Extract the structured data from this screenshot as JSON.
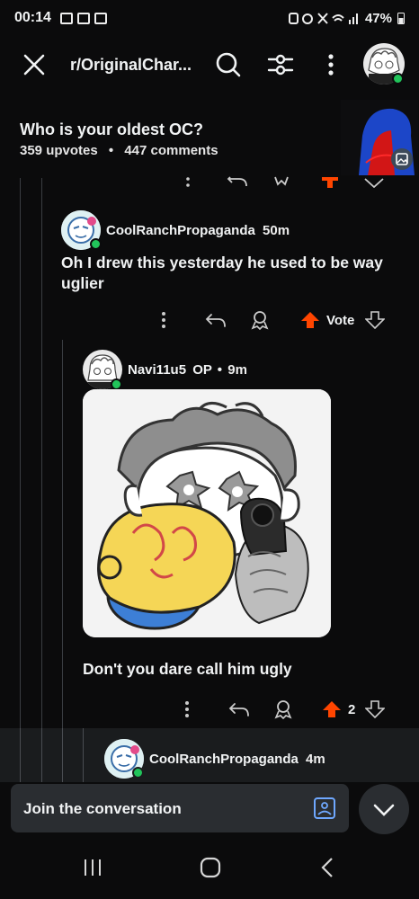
{
  "status_bar": {
    "time": "00:14",
    "battery": "47%"
  },
  "header": {
    "subreddit": "r/OriginalChar..."
  },
  "post": {
    "title": "Who is your oldest OC?",
    "upvotes": "359 upvotes",
    "separator": "•",
    "comments": "447 comments"
  },
  "comments": [
    {
      "user": "CoolRanchPropaganda",
      "time": "50m",
      "body": "Oh I drew this yesterday he used to be way uglier",
      "vote_label": "Vote"
    },
    {
      "user": "Navi11u5",
      "badge": "OP",
      "time": "9m",
      "body": "Don't you dare call him ugly",
      "vote_count": "2"
    },
    {
      "user": "CoolRanchPropaganda",
      "time": "4m"
    }
  ],
  "composer": {
    "placeholder": "Join the conversation"
  },
  "icons": {
    "close": "close-icon",
    "search": "search-icon",
    "filter": "filter-icon",
    "more": "more-vertical-icon",
    "reply": "reply-icon",
    "award": "award-icon",
    "upvote": "upvote-icon",
    "downvote": "downvote-icon",
    "image": "image-icon",
    "chevron": "chevron-down-icon"
  },
  "colors": {
    "upvote_active": "#ff4500",
    "online": "#21c45a",
    "background": "#0b0b0c"
  }
}
